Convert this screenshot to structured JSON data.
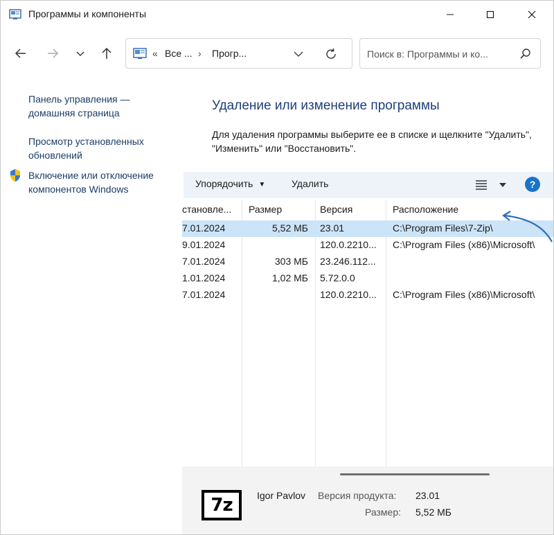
{
  "window": {
    "title": "Программы и компоненты"
  },
  "navigation": {
    "breadcrumb_sep": "«",
    "breadcrumb_1": "Все ...",
    "breadcrumb_sep2": "›",
    "breadcrumb_2": "Прогр...",
    "search_placeholder": "Поиск в: Программы и ко..."
  },
  "sidebar": {
    "home_link": "Панель управления — домашняя страница",
    "updates_link": "Просмотр установленных обновлений",
    "features_link": "Включение или отключение компонентов Windows"
  },
  "main": {
    "heading": "Удаление или изменение программы",
    "description": "Для удаления программы выберите ее в списке и щелкните \"Удалить\", \"Изменить\" или \"Восстановить\"."
  },
  "toolbar": {
    "organize_label": "Упорядочить",
    "uninstall_label": "Удалить",
    "help_label": "?"
  },
  "table": {
    "columns": [
      "становле...",
      "Размер",
      "Версия",
      "Расположение"
    ],
    "rows": [
      {
        "installed": "7.01.2024",
        "size": "5,52 МБ",
        "version": "23.01",
        "location": "C:\\Program Files\\7-Zip\\",
        "selected": true
      },
      {
        "installed": "9.01.2024",
        "size": "",
        "version": "120.0.2210...",
        "location": "C:\\Program Files (x86)\\Microsoft\\",
        "selected": false
      },
      {
        "installed": "7.01.2024",
        "size": "303 МБ",
        "version": "23.246.112...",
        "location": "",
        "selected": false
      },
      {
        "installed": "1.01.2024",
        "size": "1,02 МБ",
        "version": "5.72.0.0",
        "location": "",
        "selected": false
      },
      {
        "installed": "7.01.2024",
        "size": "",
        "version": "120.0.2210...",
        "location": "C:\\Program Files (x86)\\Microsoft\\",
        "selected": false
      }
    ]
  },
  "details": {
    "publisher": "Igor Pavlov",
    "version_label": "Версия продукта:",
    "version_value": "23.01",
    "size_label": "Размер:",
    "size_value": "5,52 МБ",
    "logo_text": "7z"
  },
  "colors": {
    "accent": "#1a73c8",
    "heading": "#1e3f7a",
    "selection": "#cce4f7",
    "toolbar": "#eef3fa"
  }
}
